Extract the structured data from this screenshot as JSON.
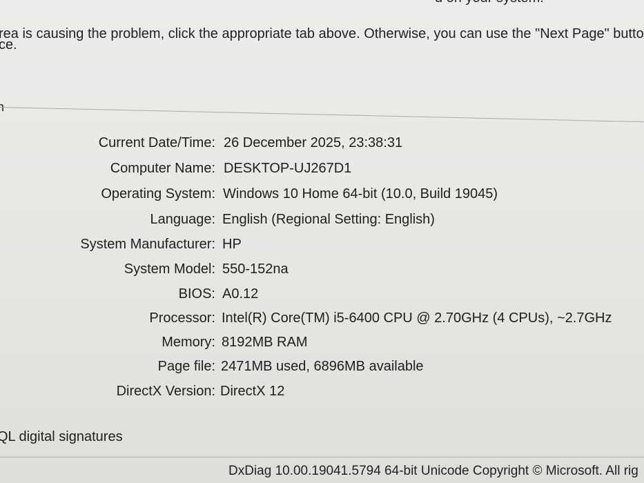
{
  "header": {
    "top_cut_text": "d on your system.",
    "line1": "rea is causing the problem, click the appropriate tab above. Otherwise, you can use the \"Next Page\" button",
    "line2": "ce."
  },
  "group_marker": "n",
  "system_info": [
    {
      "label": "Current Date/Time:",
      "value": "26 December 2025, 23:38:31"
    },
    {
      "label": "Computer Name:",
      "value": "DESKTOP-UJ267D1"
    },
    {
      "label": "Operating System:",
      "value": "Windows 10 Home 64-bit (10.0, Build 19045)"
    },
    {
      "label": "Language:",
      "value": "English (Regional Setting: English)"
    },
    {
      "label": "System Manufacturer:",
      "value": "HP"
    },
    {
      "label": "System Model:",
      "value": "550-152na"
    },
    {
      "label": "BIOS:",
      "value": "A0.12"
    },
    {
      "label": "Processor:",
      "value": "Intel(R) Core(TM) i5-6400 CPU @ 2.70GHz (4 CPUs), ~2.7GHz"
    },
    {
      "label": "Memory:",
      "value": "8192MB RAM"
    },
    {
      "label": "Page file:",
      "value": "2471MB used, 6896MB available"
    },
    {
      "label": "DirectX Version:",
      "value": "DirectX 12"
    }
  ],
  "whql": {
    "label": "QL digital signatures"
  },
  "footer": {
    "text": "DxDiag 10.00.19041.5794 64-bit Unicode  Copyright © Microsoft. All rig"
  }
}
